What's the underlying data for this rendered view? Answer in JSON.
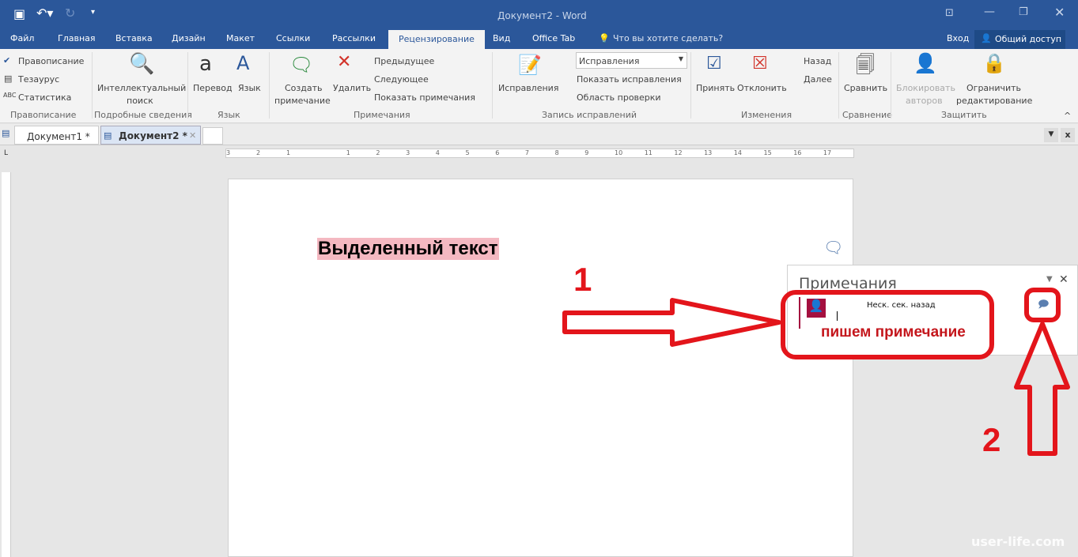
{
  "title_bar": {
    "title": "Документ2 - Word",
    "qat": [
      "save-icon",
      "undo-icon",
      "redo-icon",
      "customize-icon"
    ]
  },
  "menu_tabs": [
    "Файл",
    "Главная",
    "Вставка",
    "Дизайн",
    "Макет",
    "Ссылки",
    "Рассылки",
    "Рецензирование",
    "Вид",
    "Office Tab"
  ],
  "active_tab": "Рецензирование",
  "tell_me": "Что вы хотите сделать?",
  "signin": "Вход",
  "share": "Общий доступ",
  "ribbon": {
    "spelling": {
      "items": [
        "Правописание",
        "Тезаурус",
        "Статистика"
      ],
      "group": "Правописание"
    },
    "insights": {
      "label1": "Интеллектуальный",
      "label2": "поиск",
      "group": "Подробные сведения"
    },
    "language": {
      "translate": "Перевод",
      "language": "Язык",
      "group": "Язык"
    },
    "comments": {
      "new1": "Создать",
      "new2": "примечание",
      "delete": "Удалить",
      "prev": "Предыдущее",
      "next": "Следующее",
      "show": "Показать примечания",
      "group": "Примечания"
    },
    "tracking": {
      "track": "Исправления",
      "display_select": "Исправления",
      "show_markup": "Показать исправления",
      "pane": "Область проверки",
      "group": "Запись исправлений"
    },
    "changes": {
      "accept": "Принять",
      "reject": "Отклонить",
      "prev": "Назад",
      "next": "Далее",
      "group": "Изменения"
    },
    "compare": {
      "compare": "Сравнить",
      "group": "Сравнение"
    },
    "protect": {
      "block1": "Блокировать",
      "block2": "авторов",
      "restrict1": "Ограничить",
      "restrict2": "редактирование",
      "group": "Защитить"
    }
  },
  "doc_tabs": [
    {
      "label": "Документ1 *"
    },
    {
      "label": "Документ2 *",
      "active": true
    }
  ],
  "ruler_labels": [
    "3",
    "2",
    "1",
    "1",
    "2",
    "3",
    "4",
    "5",
    "6",
    "7",
    "8",
    "9",
    "10",
    "11",
    "12",
    "13",
    "14",
    "15",
    "16",
    "17"
  ],
  "document": {
    "highlighted_text": "Выделенный текст",
    "highlight_color": "#f4b8c1"
  },
  "comments_pane": {
    "title": "Примечания",
    "time": "Неск. сек. назад"
  },
  "annotations": {
    "label1": "1",
    "label2": "2",
    "caption": "пишем примечание",
    "color": "#e3151b"
  },
  "watermark": "user-life.com",
  "colors": {
    "accent": "#2b579a",
    "ribbon": "#f3f3f3"
  }
}
